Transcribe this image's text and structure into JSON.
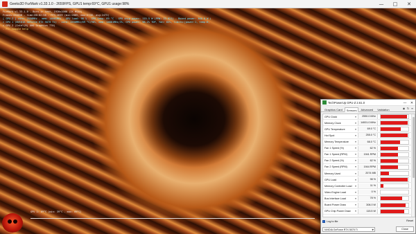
{
  "furmark": {
    "title": "Geeks3D FurMark v1.33.1.0 - 2659FPS, GPU1 temp:69°C, GPU1 usage:98%",
    "overlay_lines": [
      {
        "text": "FurMark v1.33.1.0 - Burn-in test, 1920x1080 (2X MSAA)",
        "color": "white"
      },
      {
        "text": "Frames:438858 - time:00:02:58 - FPS:2659 (min:2085, max:2738, avg:2475)",
        "color": "white"
      },
      {
        "text": "[ GPU-Z ] core: 2550MHz - mem: 14001MHz - GPU load: 98 % - GPU temp: 69 °C - GPU chip power: 115.5 W (PPW: 23.021) - Board power: 306.0 W (PPW: 8.689) - GPU voltage: 0.950 V",
        "color": "cyan"
      },
      {
        "text": "> GPU 1 (NVIDIA GeForce RTX 5070 Ti) - core: 2550MHz/69 °C/98%, mem: 14001MHz/3%, GPU power: 98.2% TDP, fan: 62%, limits:[power:1, temp:0, volt:0, OV:0]",
        "color": "cyan"
      },
      {
        "text": "> GPU 2 (Intel(R) UHD Graphics 770)",
        "color": "white"
      },
      {
        "text": "- F1: toggle help",
        "color": "yellow"
      }
    ],
    "graph_label": "GPU 1: 69°C (min: 39°C - max: 69°C)"
  },
  "gpuz": {
    "title": "TechPowerUp GPU-Z 2.61.0",
    "tabs": [
      "Graphics Card",
      "Sensors",
      "Advanced",
      "Validation"
    ],
    "active_tab": "Sensors",
    "sensors": [
      {
        "name": "GPU Clock",
        "value": "2550.0 MHz",
        "level": 0.96
      },
      {
        "name": "Memory Clock",
        "value": "14001.0 MHz",
        "level": 0.98
      },
      {
        "name": "GPU Temperature",
        "value": "69.0 °C",
        "level": 0.72
      },
      {
        "name": "Hot Spot",
        "value": "255.0 °C",
        "level": 0.97
      },
      {
        "name": "Memory Temperature",
        "value": "66.0 °C",
        "level": 0.7
      },
      {
        "name": "Fan 1 Speed (%)",
        "value": "62 %",
        "level": 0.62
      },
      {
        "name": "Fan 1 Speed (RPM)",
        "value": "1941 RPM",
        "level": 0.63
      },
      {
        "name": "Fan 2 Speed (%)",
        "value": "62 %",
        "level": 0.62
      },
      {
        "name": "Fan 2 Speed (RPM)",
        "value": "1944 RPM",
        "level": 0.63
      },
      {
        "name": "Memory Used",
        "value": "2074 MB",
        "level": 0.3
      },
      {
        "name": "GPU Load",
        "value": "98 %",
        "level": 0.98
      },
      {
        "name": "Memory Controller Load",
        "value": "11 %",
        "level": 0.11
      },
      {
        "name": "Video Engine Load",
        "value": "0 %",
        "level": 0.0
      },
      {
        "name": "Bus Interface Load",
        "value": "78 %",
        "level": 0.78
      },
      {
        "name": "Board Power Draw",
        "value": "306.0 W",
        "level": 0.9
      },
      {
        "name": "GPU Chip Power Draw",
        "value": "115.5 W",
        "level": 0.85
      }
    ],
    "log_to_file_label": "Log to file",
    "reset_label": "Reset",
    "selected_gpu": "NVIDIA GeForce RTX 5070 Ti",
    "close_label": "Close"
  }
}
